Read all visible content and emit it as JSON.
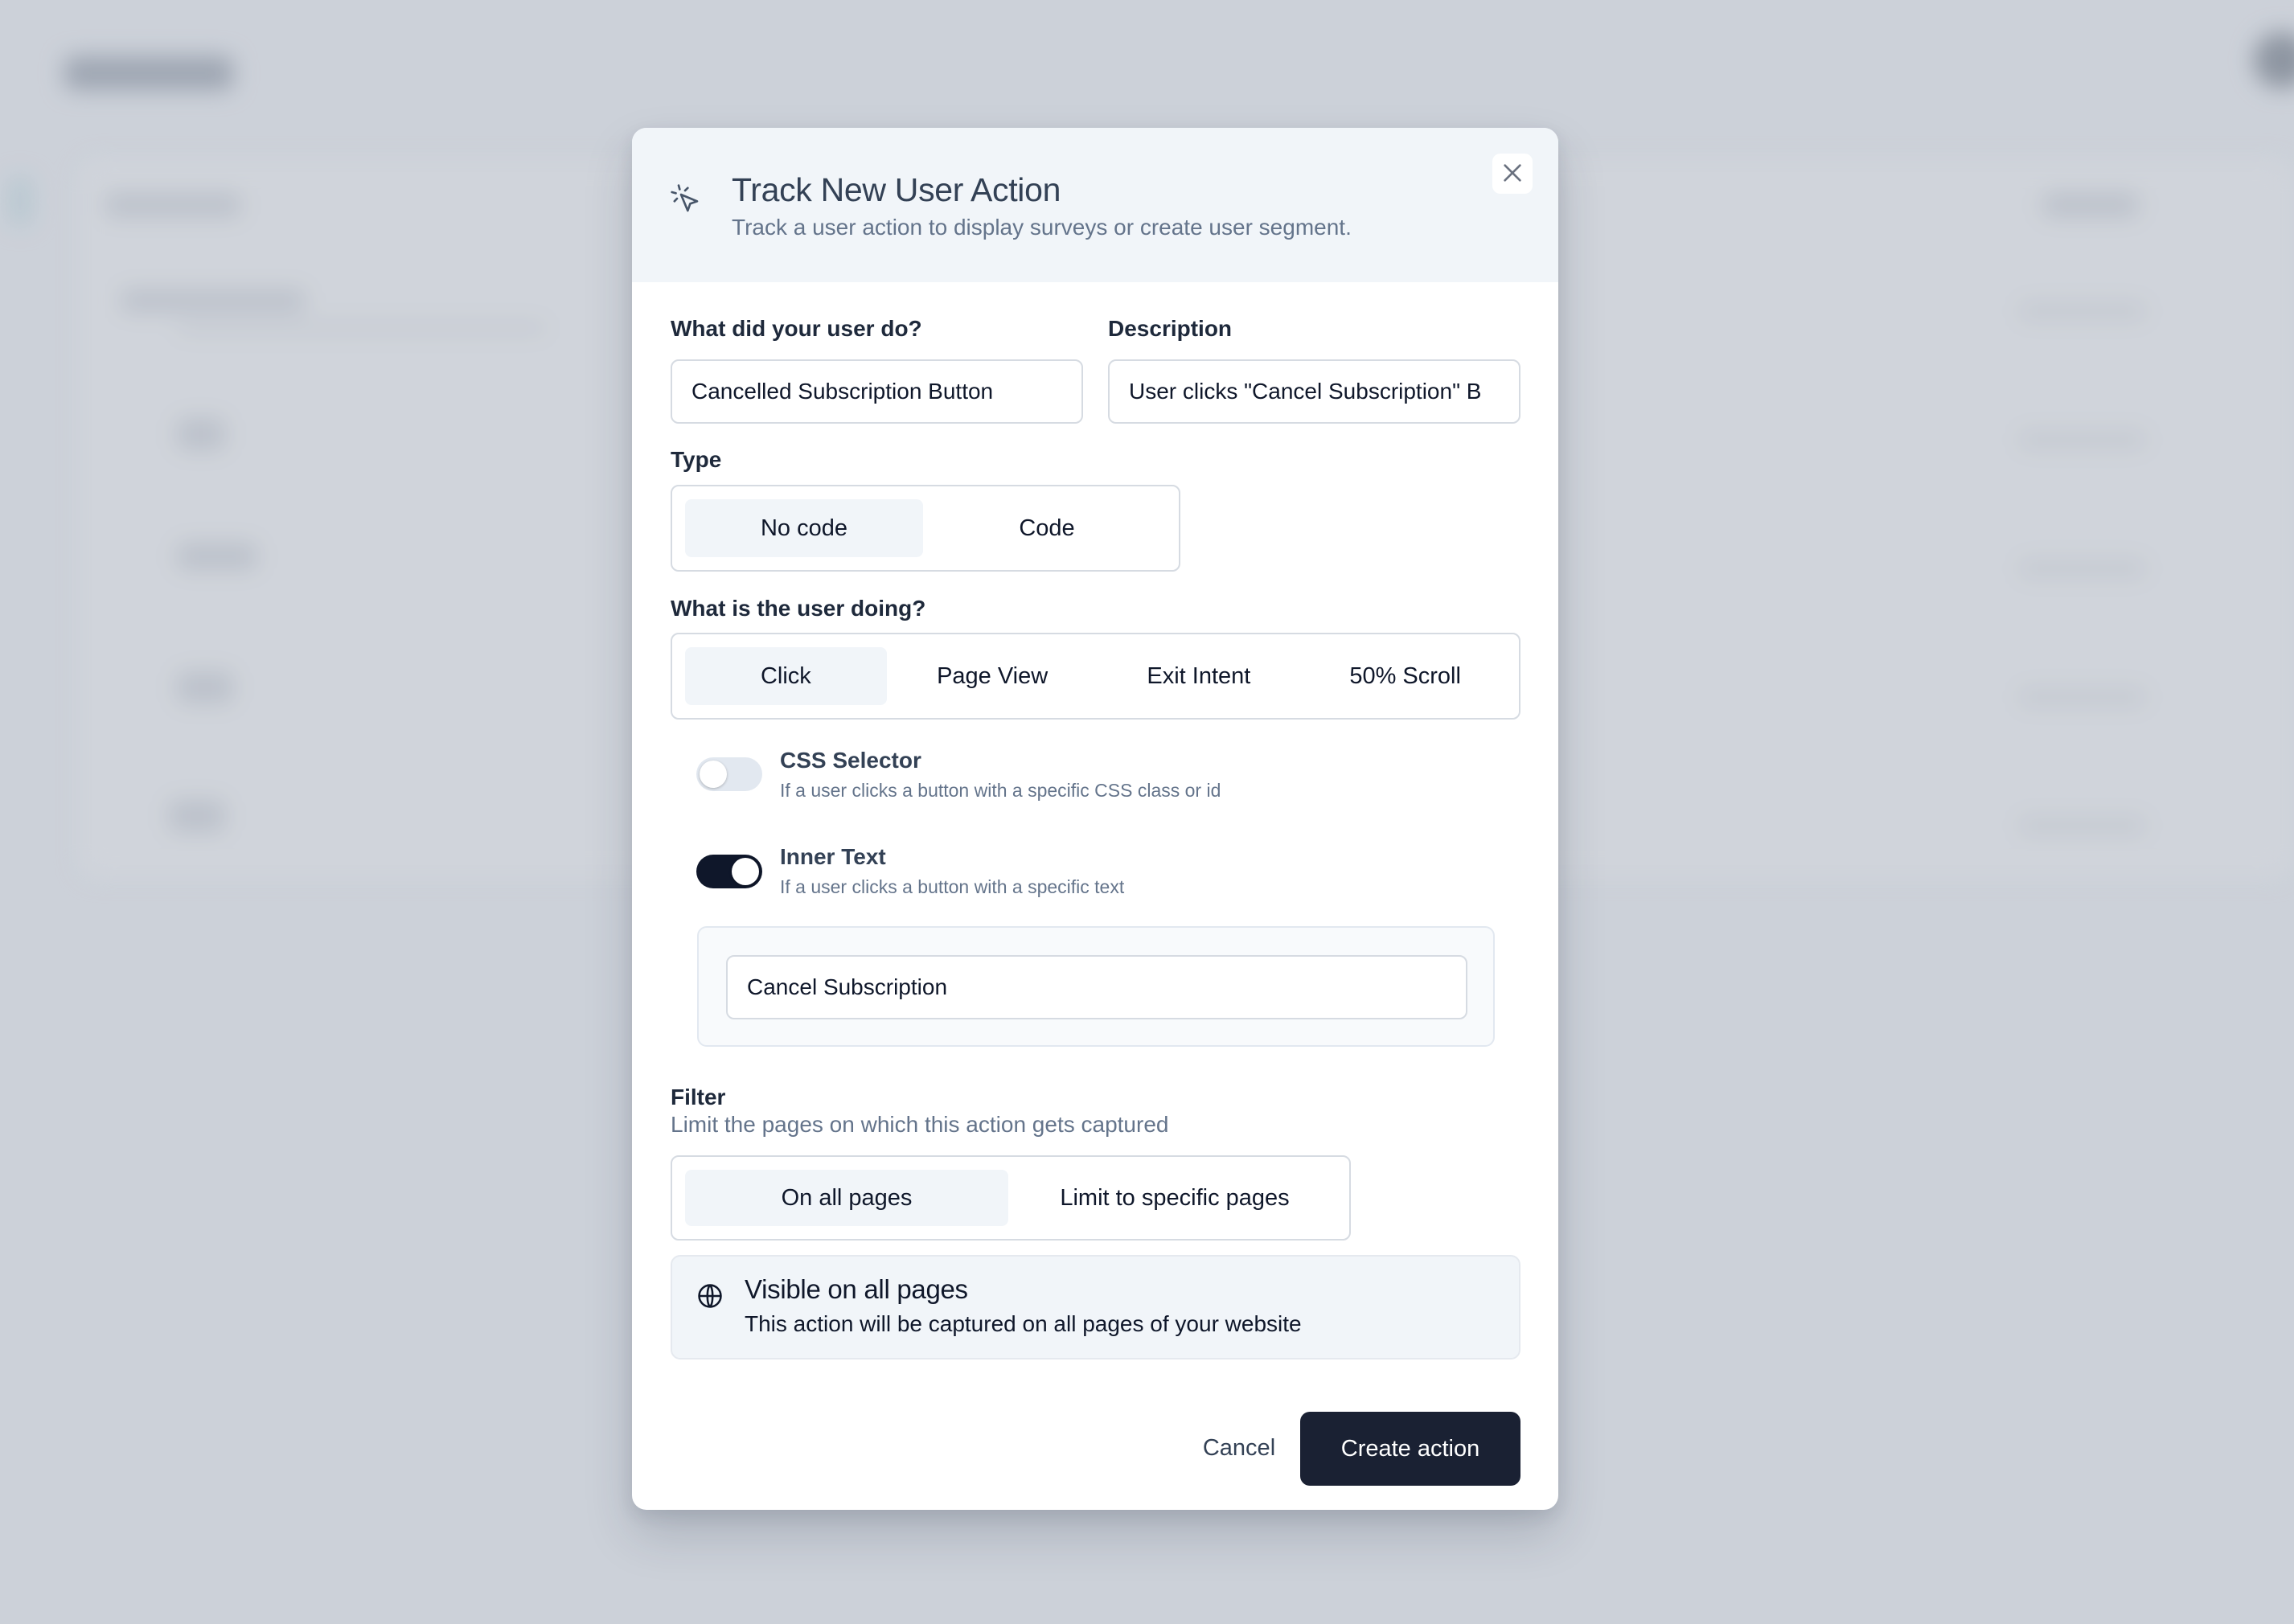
{
  "modal": {
    "title": "Track New User Action",
    "subtitle": "Track a user action to display surveys or create user segment.",
    "header_icon": "cursor-click-icon",
    "close_icon": "close-icon"
  },
  "form": {
    "name_label": "What did your user do?",
    "name_value": "Cancelled Subscription Button",
    "description_label": "Description",
    "description_value": "User clicks \"Cancel Subscription\" B",
    "type_label": "Type",
    "type_options": [
      {
        "label": "No code",
        "selected": true
      },
      {
        "label": "Code",
        "selected": false
      }
    ],
    "event_label": "What is the user doing?",
    "event_options": [
      {
        "label": "Click",
        "selected": true
      },
      {
        "label": "Page View",
        "selected": false
      },
      {
        "label": "Exit Intent",
        "selected": false
      },
      {
        "label": "50% Scroll",
        "selected": false
      }
    ],
    "css_selector": {
      "title": "CSS Selector",
      "description": "If a user clicks a button with a specific CSS class or id",
      "enabled": false
    },
    "inner_text": {
      "title": "Inner Text",
      "description": "If a user clicks a button with a specific text",
      "enabled": true,
      "value": "Cancel Subscription"
    },
    "filter": {
      "label": "Filter",
      "hint": "Limit the pages on which this action gets captured",
      "options": [
        {
          "label": "On all pages",
          "selected": true
        },
        {
          "label": "Limit to specific pages",
          "selected": false
        }
      ],
      "info_icon": "globe-icon",
      "info_title": "Visible on all pages",
      "info_description": "This action will be captured on all pages of your website"
    }
  },
  "footer": {
    "cancel_label": "Cancel",
    "create_label": "Create action"
  },
  "colors": {
    "primary_button": "#1a2133",
    "toggle_on": "#0f172a",
    "header_bg": "#f1f5f9",
    "backdrop": "#cdd2da"
  }
}
